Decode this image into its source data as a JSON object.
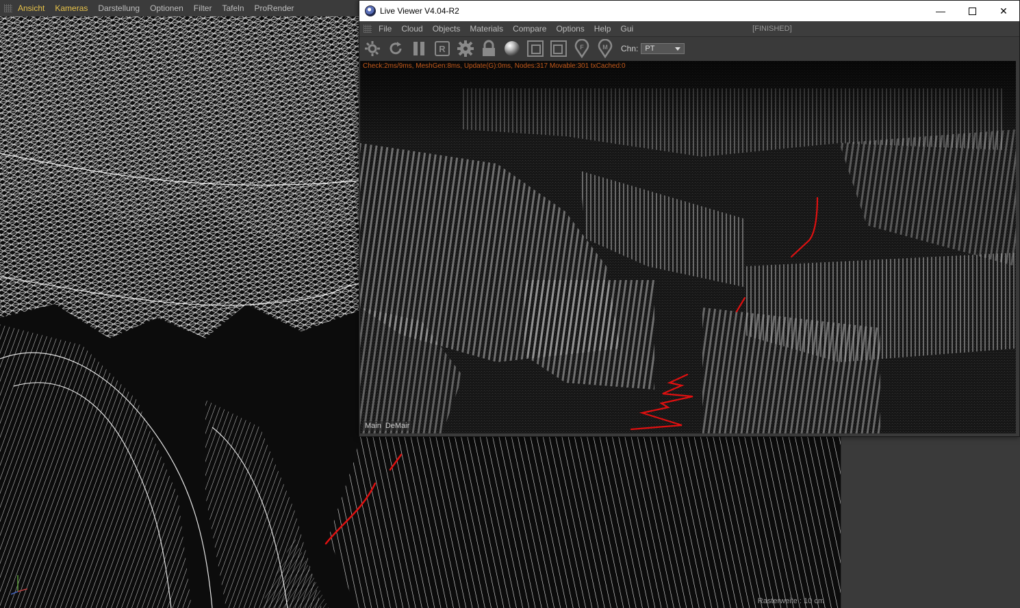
{
  "bg_menubar": {
    "items": [
      "Ansicht",
      "Kameras",
      "Darstellung",
      "Optionen",
      "Filter",
      "Tafeln",
      "ProRender"
    ]
  },
  "viewport": {
    "raster_label": "Rasterweite : 10 cm"
  },
  "live_viewer": {
    "title": "Live Viewer V4.04-R2",
    "menu": [
      "File",
      "Cloud",
      "Objects",
      "Materials",
      "Compare",
      "Options",
      "Help",
      "Gui"
    ],
    "status": "[FINISHED]",
    "toolbar_icons": [
      "settings-icon",
      "refresh-icon",
      "pause-icon",
      "region-render-icon",
      "gear-icon",
      "lock-icon",
      "material-sphere-icon",
      "copy-frame-icon",
      "paste-frame-icon",
      "focus-pin-icon",
      "material-pin-icon"
    ],
    "chn_label": "Chn:",
    "chn_value": "PT",
    "stats": "Check:2ms/9ms, MeshGen:8ms, Update(G):0ms, Nodes:317 Movable:301 txCached:0",
    "tabs": [
      "Main",
      "DeMair"
    ]
  },
  "colors": {
    "accent_menu": "#e8c34a",
    "stats_text": "#c65a1a",
    "annotation": "#e01010"
  }
}
